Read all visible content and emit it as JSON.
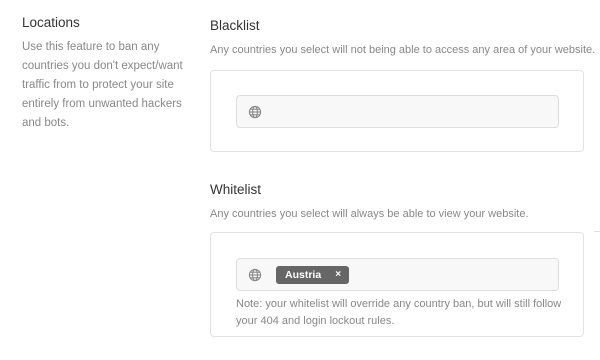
{
  "locations": {
    "title": "Locations",
    "description": "Use this feature to ban any countries you don't expect/want traffic from to protect your site entirely from unwanted hackers and bots."
  },
  "blacklist": {
    "title": "Blacklist",
    "description": "Any countries you select will not being able to access any area of your website.",
    "icon": "globe-icon",
    "selected": []
  },
  "whitelist": {
    "title": "Whitelist",
    "description": "Any countries you select will always be able to view your website.",
    "icon": "globe-icon",
    "selected": [
      {
        "label": "Austria",
        "remove": "×"
      }
    ],
    "note": "Note: your whitelist will override any country ban, but will still follow your 404 and login lockout rules."
  },
  "colors": {
    "tag_bg": "#666666",
    "border": "#e2e2e2",
    "muted_text": "#888888"
  }
}
